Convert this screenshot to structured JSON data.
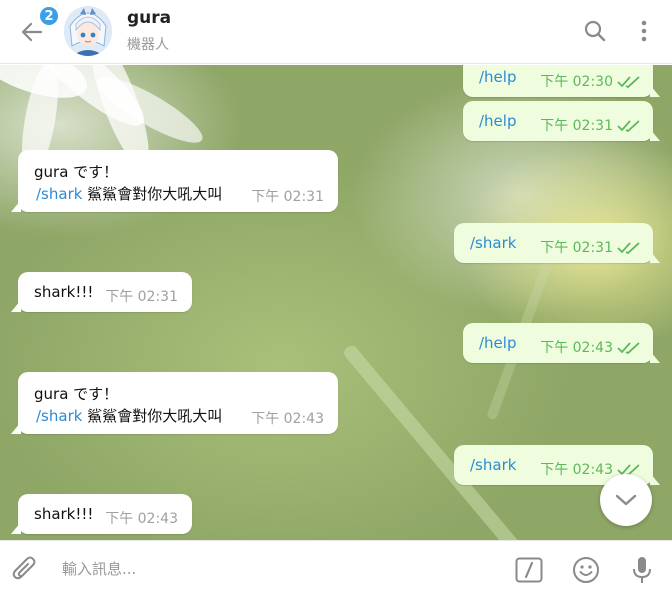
{
  "header": {
    "title": "gura",
    "subtitle": "機器人",
    "unread_badge": "2",
    "back_icon": "back-arrow-icon",
    "search_icon": "search-icon",
    "more_icon": "more-vertical-icon"
  },
  "messages": [
    {
      "side": "out",
      "text": "/help",
      "time": "下午 02:30",
      "status": "read"
    },
    {
      "side": "out",
      "text": "/help",
      "time": "下午 02:31",
      "status": "read"
    },
    {
      "side": "in",
      "line1": "gura です！",
      "cmd": "/shark",
      "rest": " 鯊鯊會對你大吼大叫",
      "time": "下午 02:31"
    },
    {
      "side": "out",
      "text": "/shark",
      "time": "下午 02:31",
      "status": "read"
    },
    {
      "side": "in",
      "text": "shark!!!",
      "time": "下午 02:31"
    },
    {
      "side": "out",
      "text": "/help",
      "time": "下午 02:43",
      "status": "read"
    },
    {
      "side": "in",
      "line1": "gura です！",
      "cmd": "/shark",
      "rest": " 鯊鯊會對你大吼大叫",
      "time": "下午 02:43"
    },
    {
      "side": "out",
      "text": "/shark",
      "time": "下午 02:43",
      "status": "read"
    },
    {
      "side": "in",
      "text": "shark!!!",
      "time": "下午 02:43"
    }
  ],
  "input": {
    "placeholder": "輸入訊息...",
    "attach_icon": "paperclip-icon",
    "command_icon": "slash-command-icon",
    "emoji_icon": "emoji-icon",
    "mic_icon": "microphone-icon"
  },
  "colors": {
    "accent": "#3a9ee8",
    "command_link": "#2d8bd4",
    "outgoing_bubble": "#effdde",
    "read_check": "#5cb85c"
  }
}
